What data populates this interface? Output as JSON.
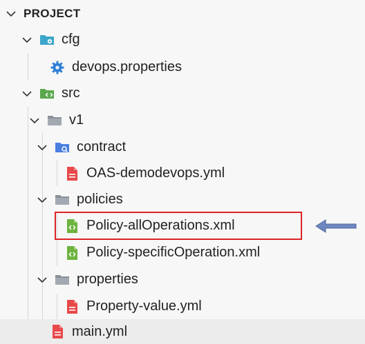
{
  "explorer": {
    "header": "PROJECT",
    "items": [
      {
        "label": "cfg",
        "icon": "config-folder-icon"
      },
      {
        "label": "devops.properties",
        "icon": "gear-icon"
      },
      {
        "label": "src",
        "icon": "source-folder-icon"
      },
      {
        "label": "v1",
        "icon": "folder-icon"
      },
      {
        "label": "contract",
        "icon": "contract-folder-icon"
      },
      {
        "label": "OAS-demodevops.yml",
        "icon": "yaml-file-icon"
      },
      {
        "label": "policies",
        "icon": "folder-icon"
      },
      {
        "label": "Policy-allOperations.xml",
        "icon": "xml-file-icon"
      },
      {
        "label": "Policy-specificOperation.xml",
        "icon": "xml-file-icon"
      },
      {
        "label": "properties",
        "icon": "folder-icon"
      },
      {
        "label": "Property-value.yml",
        "icon": "yaml-file-icon"
      },
      {
        "label": "main.yml",
        "icon": "yaml-file-icon"
      }
    ]
  },
  "colors": {
    "highlight": "#dd2222",
    "arrow": "#6f87bf",
    "yaml": "#e8484a",
    "xml": "#6db33f",
    "config": "#3ba6c9",
    "source": "#5aa84c",
    "contract": "#4a7fe0",
    "folder": "#8a9099"
  }
}
